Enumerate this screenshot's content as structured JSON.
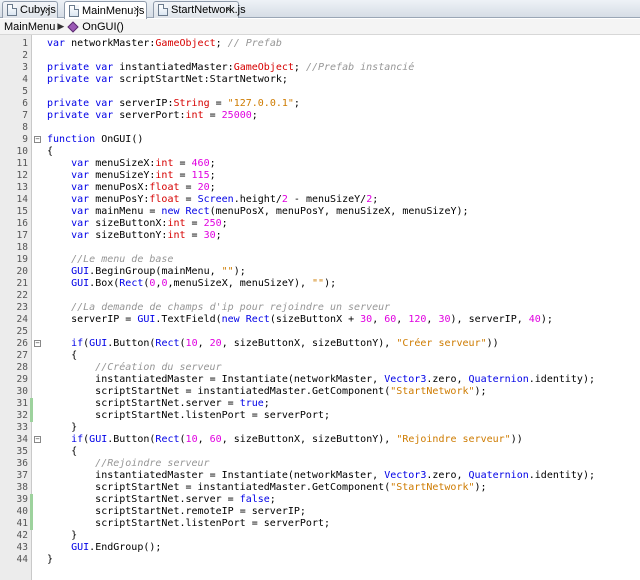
{
  "tabs": [
    {
      "label": "Cuby.js",
      "active": false
    },
    {
      "label": "MainMenu.js",
      "active": true
    },
    {
      "label": "StartNetwork.js",
      "active": false
    }
  ],
  "tab_close_glyph": "×",
  "breadcrumb": {
    "items": [
      "MainMenu",
      "OnGUI()"
    ]
  },
  "colors": {
    "keyword": "#0000e6",
    "type": "#d60000",
    "string": "#ce7b00",
    "number": "#e000e0",
    "comment": "#969696",
    "change_marker": "#9dd29d"
  },
  "code_lines": [
    {
      "n": "1",
      "code": "var networkMaster:GameObject; // Prefab"
    },
    {
      "n": "2",
      "code": ""
    },
    {
      "n": "3",
      "code": "private var instantiatedMaster:GameObject; //Prefab instancié"
    },
    {
      "n": "4",
      "code": "private var scriptStartNet:StartNetwork;"
    },
    {
      "n": "5",
      "code": ""
    },
    {
      "n": "6",
      "code": "private var serverIP:String = \"127.0.0.1\";"
    },
    {
      "n": "7",
      "code": "private var serverPort:int = 25000;"
    },
    {
      "n": "8",
      "code": ""
    },
    {
      "n": "9",
      "code": "function OnGUI()",
      "fold": true
    },
    {
      "n": "10",
      "code": "{"
    },
    {
      "n": "11",
      "code": "    var menuSizeX:int = 460;"
    },
    {
      "n": "12",
      "code": "    var menuSizeY:int = 115;"
    },
    {
      "n": "13",
      "code": "    var menuPosX:float = 20;"
    },
    {
      "n": "14",
      "code": "    var menuPosY:float = Screen.height/2 - menuSizeY/2;"
    },
    {
      "n": "15",
      "code": "    var mainMenu = new Rect(menuPosX, menuPosY, menuSizeX, menuSizeY);"
    },
    {
      "n": "16",
      "code": "    var sizeButtonX:int = 250;"
    },
    {
      "n": "17",
      "code": "    var sizeButtonY:int = 30;"
    },
    {
      "n": "18",
      "code": ""
    },
    {
      "n": "19",
      "code": "    //Le menu de base"
    },
    {
      "n": "20",
      "code": "    GUI.BeginGroup(mainMenu, \"\");"
    },
    {
      "n": "21",
      "code": "    GUI.Box(Rect(0,0,menuSizeX, menuSizeY), \"\");"
    },
    {
      "n": "22",
      "code": ""
    },
    {
      "n": "23",
      "code": "    //La demande de champs d'ip pour rejoindre un serveur"
    },
    {
      "n": "24",
      "code": "    serverIP = GUI.TextField(new Rect(sizeButtonX + 30, 60, 120, 30), serverIP, 40);"
    },
    {
      "n": "25",
      "code": ""
    },
    {
      "n": "26",
      "code": "    if(GUI.Button(Rect(10, 20, sizeButtonX, sizeButtonY), \"Créer serveur\"))",
      "fold": true
    },
    {
      "n": "27",
      "code": "    {"
    },
    {
      "n": "28",
      "code": "        //Création du serveur"
    },
    {
      "n": "29",
      "code": "        instantiatedMaster = Instantiate(networkMaster, Vector3.zero, Quaternion.identity);"
    },
    {
      "n": "30",
      "code": "        scriptStartNet = instantiatedMaster.GetComponent(\"StartNetwork\");"
    },
    {
      "n": "31",
      "code": "        scriptStartNet.server = true;",
      "changed": true
    },
    {
      "n": "32",
      "code": "        scriptStartNet.listenPort = serverPort;",
      "changed": true
    },
    {
      "n": "33",
      "code": "    }"
    },
    {
      "n": "34",
      "code": "    if(GUI.Button(Rect(10, 60, sizeButtonX, sizeButtonY), \"Rejoindre serveur\"))",
      "fold": true
    },
    {
      "n": "35",
      "code": "    {"
    },
    {
      "n": "36",
      "code": "        //Rejoindre serveur"
    },
    {
      "n": "37",
      "code": "        instantiatedMaster = Instantiate(networkMaster, Vector3.zero, Quaternion.identity);"
    },
    {
      "n": "38",
      "code": "        scriptStartNet = instantiatedMaster.GetComponent(\"StartNetwork\");"
    },
    {
      "n": "39",
      "code": "        scriptStartNet.server = false;",
      "changed": true
    },
    {
      "n": "40",
      "code": "        scriptStartNet.remoteIP = serverIP;",
      "changed": true
    },
    {
      "n": "41",
      "code": "        scriptStartNet.listenPort = serverPort;",
      "changed": true
    },
    {
      "n": "42",
      "code": "    }"
    },
    {
      "n": "43",
      "code": "    GUI.EndGroup();"
    },
    {
      "n": "44",
      "code": "}"
    }
  ]
}
